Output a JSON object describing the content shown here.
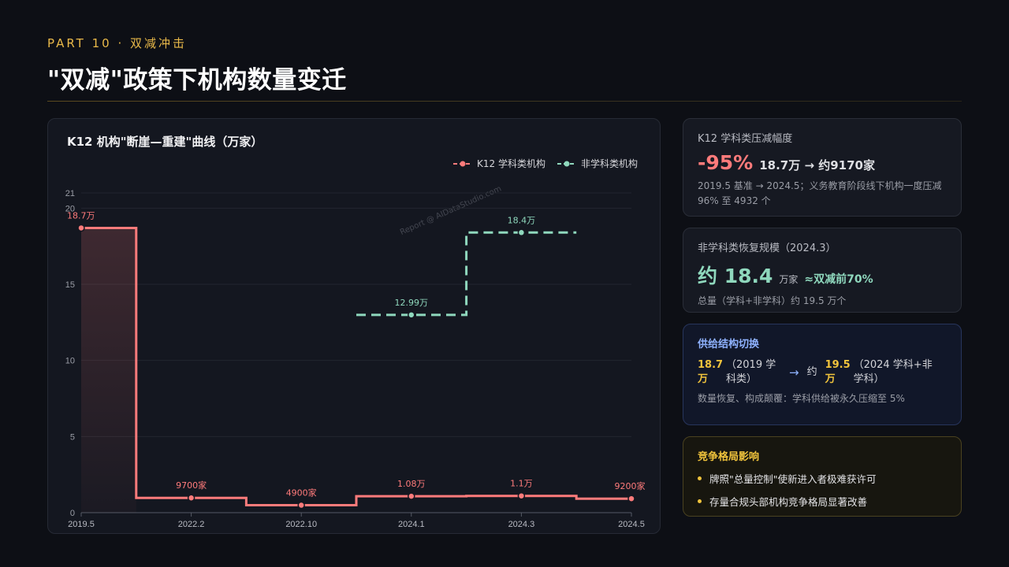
{
  "header": {
    "kicker": "PART 10 · 双减冲击",
    "title": "\"双减\"政策下机构数量变迁"
  },
  "watermark": "Report @ AIDataStudio.com",
  "colors": {
    "k12": "#ff7b7b",
    "non_academic": "#8fd8bd",
    "accent_gold": "#f0c33c",
    "accent_blue": "#8fb2ff"
  },
  "chart_data": {
    "type": "line",
    "title": "K12 机构\"断崖—重建\"曲线（万家）",
    "categories": [
      "2019.5",
      "2022.2",
      "2022.10",
      "2024.1",
      "2024.3",
      "2024.5"
    ],
    "y_ticks": [
      0,
      5,
      10,
      15,
      20,
      21
    ],
    "ylim": [
      0,
      21
    ],
    "step": true,
    "grid": true,
    "legend_position": "top-right",
    "series": [
      {
        "name": "K12 学科类机构",
        "values": [
          18.7,
          0.97,
          0.49,
          1.08,
          1.1,
          0.92
        ],
        "labels": [
          "18.7万",
          "9700家",
          "4900家",
          "1.08万",
          "1.1万",
          "9200家"
        ]
      },
      {
        "name": "非学科类机构",
        "values": [
          null,
          null,
          null,
          12.99,
          18.4,
          null
        ],
        "labels": [
          "",
          "",
          "",
          "12.99万",
          "18.4万",
          ""
        ]
      }
    ]
  },
  "cards": {
    "reduction": {
      "label": "K12 学科类压减幅度",
      "big": "-95%",
      "detail": "18.7万 → 约9170家",
      "note": "2019.5 基准 → 2024.5；义务教育阶段线下机构一度压减 96% 至 4932 个"
    },
    "recovery": {
      "label": "非学科类恢复规模（2024.3）",
      "big": "约 18.4",
      "unit": "万家",
      "compare": "≈双减前70%",
      "note": "总量（学科+非学科）约 19.5 万个"
    },
    "shift": {
      "title": "供给结构切换",
      "from_value": "18.7万",
      "from_desc": "（2019 学科类）",
      "arrow": "→",
      "approx": "约",
      "to_value": "19.5万",
      "to_desc": "（2024 学科+非学科）",
      "note": "数量恢复、构成颠覆：学科供给被永久压缩至 5%"
    },
    "competition": {
      "title": "竞争格局影响",
      "items": [
        "牌照\"总量控制\"使新进入者极难获许可",
        "存量合规头部机构竞争格局显著改善"
      ]
    }
  }
}
